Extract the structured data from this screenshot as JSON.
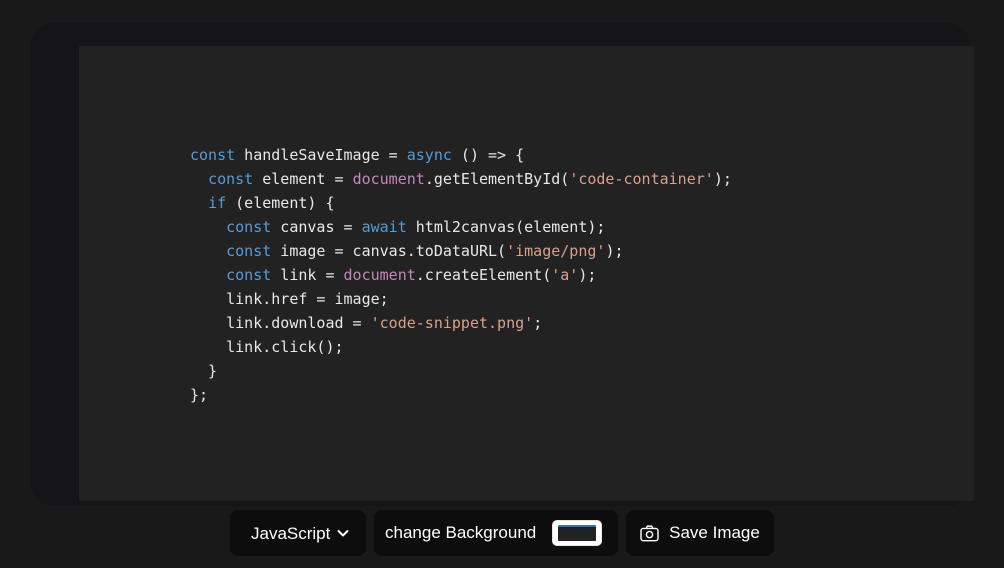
{
  "app": {
    "background_color": "#191919",
    "card_background_color": "#222222",
    "button_background_color": "#0d0d0d"
  },
  "code": {
    "language": "JavaScript",
    "theme_colors": {
      "keyword": "#569cd6",
      "object": "#c586c0",
      "string": "#d9a18a",
      "plain": "#e8e8e8"
    },
    "lines": [
      [
        {
          "t": "const",
          "c": "kw"
        },
        {
          "t": " handleSaveImage = ",
          "c": "pl"
        },
        {
          "t": "async",
          "c": "kw"
        },
        {
          "t": " () => {",
          "c": "pl"
        }
      ],
      [
        {
          "t": "  ",
          "c": "pl"
        },
        {
          "t": "const",
          "c": "kw"
        },
        {
          "t": " element = ",
          "c": "pl"
        },
        {
          "t": "document",
          "c": "obj"
        },
        {
          "t": ".getElementById(",
          "c": "pl"
        },
        {
          "t": "'code-container'",
          "c": "str"
        },
        {
          "t": ");",
          "c": "pl"
        }
      ],
      [
        {
          "t": "  ",
          "c": "pl"
        },
        {
          "t": "if",
          "c": "kw"
        },
        {
          "t": " (element) {",
          "c": "pl"
        }
      ],
      [
        {
          "t": "    ",
          "c": "pl"
        },
        {
          "t": "const",
          "c": "kw"
        },
        {
          "t": " canvas = ",
          "c": "pl"
        },
        {
          "t": "await",
          "c": "kw"
        },
        {
          "t": " html2canvas(element);",
          "c": "pl"
        }
      ],
      [
        {
          "t": "    ",
          "c": "pl"
        },
        {
          "t": "const",
          "c": "kw"
        },
        {
          "t": " image = canvas.toDataURL(",
          "c": "pl"
        },
        {
          "t": "'image/png'",
          "c": "str"
        },
        {
          "t": ");",
          "c": "pl"
        }
      ],
      [
        {
          "t": "    ",
          "c": "pl"
        },
        {
          "t": "const",
          "c": "kw"
        },
        {
          "t": " link = ",
          "c": "pl"
        },
        {
          "t": "document",
          "c": "obj"
        },
        {
          "t": ".createElement(",
          "c": "pl"
        },
        {
          "t": "'a'",
          "c": "str"
        },
        {
          "t": ");",
          "c": "pl"
        }
      ],
      [
        {
          "t": "    link.href = image;",
          "c": "pl"
        }
      ],
      [
        {
          "t": "    link.download = ",
          "c": "pl"
        },
        {
          "t": "'code-snippet.png'",
          "c": "str"
        },
        {
          "t": ";",
          "c": "pl"
        }
      ],
      [
        {
          "t": "    link.click();",
          "c": "pl"
        }
      ],
      [
        {
          "t": "  }",
          "c": "pl"
        }
      ],
      [
        {
          "t": "};",
          "c": "pl"
        }
      ]
    ]
  },
  "toolbar": {
    "language_select": {
      "selected": "JavaScript",
      "options": [
        "JavaScript"
      ],
      "chevron_icon": "chevron-down-icon"
    },
    "change_background": {
      "label": "change Background",
      "color_value": "#222222",
      "picker_icon": "color-swatch-icon"
    },
    "save_image": {
      "label": "Save Image",
      "icon": "camera-icon"
    }
  }
}
